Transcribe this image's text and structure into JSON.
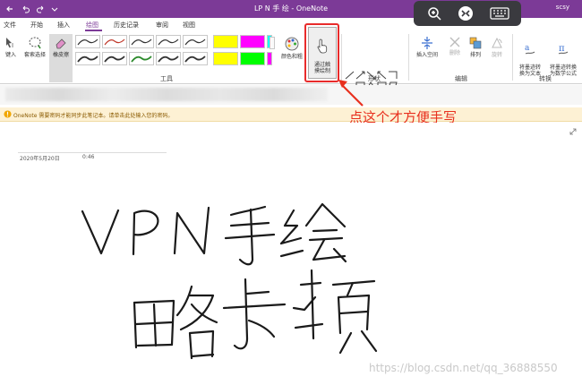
{
  "titlebar": {
    "title": "LP N 手 绘  -  OneNote",
    "user": "scsy",
    "icons": [
      "back-arrow-icon",
      "undo-icon",
      "redo-icon",
      "dropdown-icon"
    ]
  },
  "touch_toolbar": {
    "icons": [
      "zoom-in-icon",
      "remote-connection-icon",
      "keyboard-icon"
    ]
  },
  "menu": {
    "tabs": [
      {
        "label": "文件"
      },
      {
        "label": "开始"
      },
      {
        "label": "插入"
      },
      {
        "label": "绘图",
        "active": true
      },
      {
        "label": "历史记录"
      },
      {
        "label": "审阅"
      },
      {
        "label": "视图"
      }
    ]
  },
  "ribbon": {
    "type_label": "键入",
    "lasso_label": "套索选择",
    "eraser_label": "橡皮擦",
    "color_label": "颜色和粗",
    "touchdraw_label": "通过触\n摸绘制",
    "insert_space_label": "插入空间",
    "delete_label": "删除",
    "arrange_label": "排列",
    "rotate_label": "旋转",
    "ink_to_text_label": "将墨迹转\n换为文本",
    "ink_to_math_label": "将墨迹转换\n为数学公式",
    "groups": {
      "tools": "工具",
      "shapes": "形状",
      "edit": "编辑",
      "convert": "转换"
    },
    "pen_colors": [
      "#333333",
      "#c0392b",
      "#333333",
      "#333333",
      "#333333",
      "#333333",
      "#333333",
      "#2c8a2c",
      "#333333",
      "#333333"
    ],
    "highlighter_colors": [
      "#ffff00",
      "#ff00ff",
      "#00ffff",
      "#ffff00",
      "#00ff00",
      "#ff00ff"
    ]
  },
  "notice": {
    "text": "OneNote 需要密码才能同步此笔记本。请单击此处输入您的密码。"
  },
  "annotation": {
    "text": "点这个才方便手写"
  },
  "page": {
    "date": "2020年5月20日",
    "time": "0:46"
  },
  "watermark": "https://blog.csdn.net/qq_36888550"
}
